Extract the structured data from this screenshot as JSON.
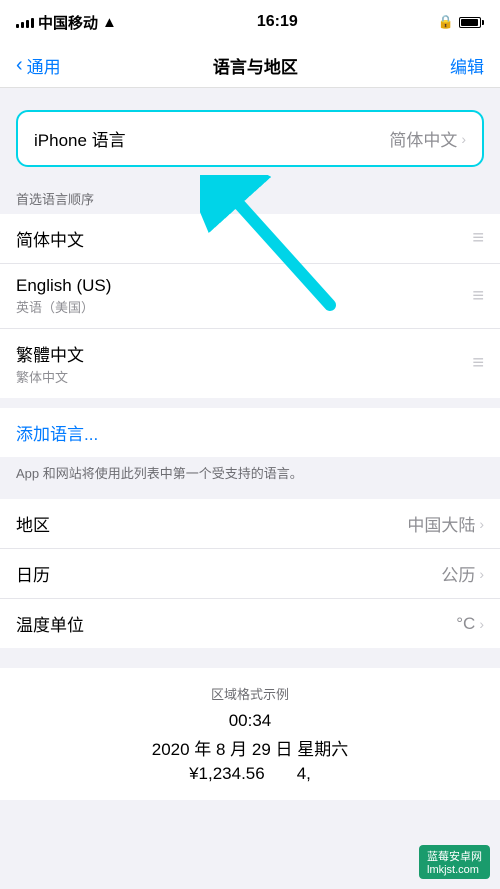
{
  "statusBar": {
    "carrier": "中国移动",
    "time": "16:19",
    "battery": "100%",
    "batteryIcon": "🔋"
  },
  "navBar": {
    "backLabel": "通用",
    "title": "语言与地区",
    "actionLabel": "编辑"
  },
  "iphoneLanguage": {
    "label": "iPhone 语言",
    "value": "简体中文"
  },
  "preferredSection": {
    "sectionLabel": "首选语言顺序",
    "languages": [
      {
        "main": "简体中文",
        "sub": ""
      },
      {
        "main": "English (US)",
        "sub": "英语（美国）"
      },
      {
        "main": "繁體中文",
        "sub": "繁体中文"
      }
    ],
    "addLabel": "添加语言..."
  },
  "helperText": "App 和网站将使用此列表中第一个受支持的语言。",
  "settingsRows": [
    {
      "label": "地区",
      "value": "中国大陆"
    },
    {
      "label": "日历",
      "value": "公历"
    },
    {
      "label": "温度单位",
      "value": "°C"
    }
  ],
  "formatExample": {
    "title": "区域格式示例",
    "time": "00:34",
    "date": "2020 年 8 月 29 日 星期六",
    "number1": "¥1,234.56",
    "number2": "4,"
  },
  "watermark": {
    "text": "蓝莓安卓网",
    "subtext": "lmkjst.com"
  }
}
